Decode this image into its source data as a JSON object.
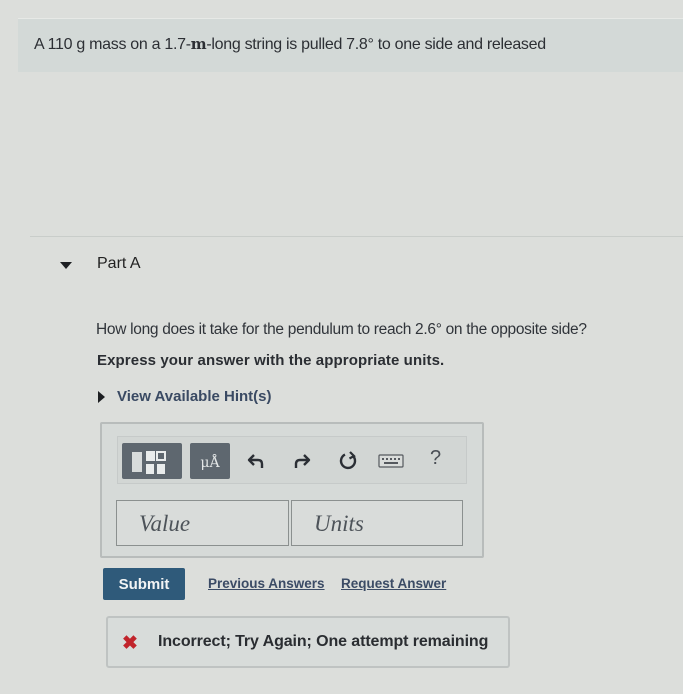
{
  "problem": {
    "text_before": "A 110 g mass on a 1.7-",
    "unit_m": "m",
    "text_after": "-long string is pulled 7.8° to one side and released"
  },
  "part": {
    "label": "Part A",
    "question": "How long does it take for the pendulum to reach 2.6° on the opposite side?",
    "instruction": "Express your answer with the appropriate units.",
    "hint_link": "View Available Hint(s)"
  },
  "toolbar": {
    "template_icon": "templates-icon",
    "units_label": "μÅ",
    "undo_icon": "undo-icon",
    "redo_icon": "redo-icon",
    "reset_icon": "reset-icon",
    "keyboard_icon": "keyboard-icon",
    "help_label": "?"
  },
  "answer": {
    "value_placeholder": "Value",
    "units_placeholder": "Units"
  },
  "actions": {
    "submit_label": "Submit",
    "previous_answers": "Previous Answers",
    "request_answer": "Request Answer"
  },
  "feedback": {
    "icon": "x-icon",
    "message": "Incorrect; Try Again; One attempt remaining",
    "color": "#c1242b"
  }
}
